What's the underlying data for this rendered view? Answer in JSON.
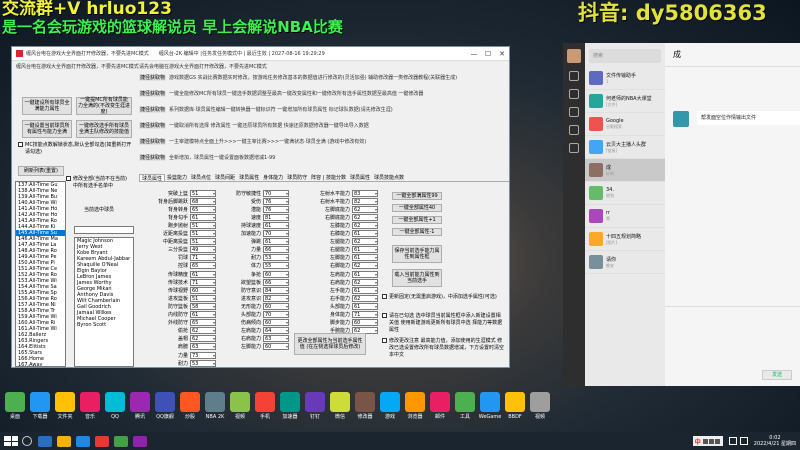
{
  "overlay": {
    "line1": "交流群+V hrluo123",
    "line2": "是一名会玩游戏的篮球解说员 早上会解说NBA比赛",
    "douyin": "抖音: dy5806363"
  },
  "window": {
    "title": "缠风台电在游戏大全界面打开修改器，不要先进MC模式",
    "title_extra": "缠风台-2K 编辑中 |任务发任务模式中 | 最近生效 | 2027-08-16 19:29:29",
    "close": "✕",
    "min": "—",
    "max": "☐"
  },
  "colors": {
    "overlay_yellow": "#f2f23a",
    "overlay_green": "#3cf250",
    "selection": "#0078d7"
  },
  "subtitle": [
    "缠风台电在游戏大全界面打开修改器，不要先进MC模式",
    "请先会电脑在游戏大全界面打开修改器，不要先进MC模式"
  ],
  "hotkeys": [
    {
      "k": "捷径获取物",
      "v": "游戏数据GS  实战比赛数据实时修改，按游戏任务修改基本的数据值进行修改的(灵活加强)  辅助修改器一类修改器教程(关联器生成)"
    },
    {
      "k": "捷径获取物",
      "v": "一键全能修改MC所有球员一键选手数据调整至最高一键改变属性和一键修改所有选手属性数据至最高值 一键修改器"
    },
    {
      "k": "捷径获取物",
      "v": "系列数据库·球员属性编辑一键转换器一键标识符 一键增加所有球员属性 标记球队数据(请先修改生涯)"
    },
    {
      "k": "捷径获取物",
      "v": "一键取消所有选择 修改属性 一键还原球员所有数据 快速还原数据修改器一键导出导入数据"
    },
    {
      "k": "捷径获取物",
      "v": "一主宰建模特点全面上升>>>一键主宰比赛>>>一键满状态·球员全满 (游戏中修改有效)"
    },
    {
      "k": "捷径获取物",
      "v": "全新增加，球员属性一键设置面板数据增减1-99"
    }
  ],
  "left_buttons": [
    "一键建设所有球员全满能力属性",
    "一键提MC所有球员能力全满的(不改变生涯进度)",
    "一键设置当前球员所有属性与能力全满",
    "一键修改选手所有球员全满主队修改的技能值"
  ],
  "left_check": "MC技能点数解锁状态,默认全部勾选(如重新打开请勾选)",
  "refresh_btn": "刷新列表(重置)",
  "right_chk_note": "修改全部(当前不在当前)中所有选手名单中",
  "select_btn": "当前选中球员",
  "player_list": [
    "137.All-Time Gu",
    "138.All-Time Ne",
    "139.All-Time Bu",
    "140.All-Time Wi",
    "141.All-Time Ho",
    "142.All-Time Ho",
    "143.All-Time Ro",
    "144.All-Time Ki",
    "145.All-Time Su",
    "146.All-Time Ma",
    "147.All-Time La",
    "148.All-Time Ro",
    "149.All-Time Pe",
    "150.All-Time Pi",
    "151.All-Time Ce",
    "152.All-Time Ro",
    "153.All-Time Wi",
    "154.All-Time Sa",
    "155.All-Time Sp",
    "156.All-Time Ro",
    "157.All-Time Ni",
    "158.All-Time Tr",
    "159.All-Time Wi",
    "160.All-Time Ri",
    "161.All-Time Wi",
    "162.Ballerz",
    "163.Ringers",
    "164.Elitists",
    "165.Stars",
    "166.Home",
    "167.Away",
    "168.USA",
    "169.World"
  ],
  "selected_player_index": 8,
  "roster": [
    "Magic Johnson",
    "Jerry West",
    "Kobe Bryant",
    "Kareem Abdul-Jabbar",
    "Shaquille O'Neal",
    "Elgin Baylor",
    "LeBron James",
    "James Worthy",
    "George Mikan",
    "Anthony Davis",
    "Wilt Chamberlain",
    "Gail Goodrich",
    "Jamaal Wilkes",
    "Michael Cooper",
    "Byron Scott"
  ],
  "tabs": [
    "球员属性",
    "投篮能力",
    "球员点位",
    "球员间距",
    "球员属性",
    "身体能力",
    "球员防守",
    "阵容 | 技能分数",
    "球员属性",
    "球员技能点数"
  ],
  "col1": [
    [
      "突破上篮",
      "51"
    ],
    [
      "背身后脚跳跃",
      "68"
    ],
    [
      "背身转身",
      "65"
    ],
    [
      "背身勾手",
      "61"
    ],
    [
      "跑步抛射",
      "51"
    ],
    [
      "近距离投篮",
      "51"
    ],
    [
      "中距离投篮",
      "51"
    ],
    [
      "三分投篮",
      "49"
    ],
    [
      "罚球",
      "71"
    ],
    [
      "控球",
      "65"
    ],
    [
      "传球精度",
      "61"
    ],
    [
      "传球技术",
      "71"
    ],
    [
      "传球视野",
      "60"
    ],
    [
      "进攻篮板",
      "51"
    ],
    [
      "防守篮板",
      "58"
    ],
    [
      "内线防守",
      "61"
    ],
    [
      "外线防守",
      "65"
    ],
    [
      "偷抢",
      "62"
    ],
    [
      "盖帽",
      "62"
    ],
    [
      "肩膀",
      "63"
    ],
    [
      "力量",
      "73"
    ],
    [
      "耐力",
      "53"
    ]
  ],
  "col2": [
    [
      "防守敏捷性",
      "70"
    ],
    [
      "受伤",
      "76"
    ],
    [
      "潜能",
      "76"
    ],
    [
      "速度",
      "81"
    ],
    [
      "持球速度",
      "61"
    ],
    [
      "加速能力",
      "70"
    ],
    [
      "弹跳",
      "61"
    ],
    [
      "力量",
      "66"
    ],
    [
      "耐力",
      "53"
    ],
    [
      "体力",
      "55"
    ],
    [
      "争抢",
      "60"
    ],
    [
      "欲望篮板",
      "66"
    ],
    [
      "防守意识",
      "84"
    ],
    [
      "进攻意识",
      "82"
    ],
    [
      "无形能力",
      "60"
    ],
    [
      "头部能力",
      "70"
    ],
    [
      "伤病倾向",
      "60"
    ],
    [
      "左肩能力",
      "64"
    ],
    [
      "右肩能力",
      "63"
    ],
    [
      "左脚能力",
      "60"
    ]
  ],
  "col3": [
    [
      "左射水平能力",
      "83"
    ],
    [
      "右射水平能力",
      "82"
    ],
    [
      "左脚底能力",
      "62"
    ],
    [
      "右脚底能力",
      "62"
    ],
    [
      "左膝能力",
      "62"
    ],
    [
      "右膝能力",
      "61"
    ],
    [
      "左腿能力",
      "62"
    ],
    [
      "右腿能力",
      "61"
    ],
    [
      "左脚能力",
      "61"
    ],
    [
      "右脚能力",
      "62"
    ],
    [
      "左肩能力",
      "61"
    ],
    [
      "右肩能力",
      "62"
    ],
    [
      "左手能力",
      "61"
    ],
    [
      "右手能力",
      "62"
    ],
    [
      "头部能力",
      "61"
    ],
    [
      "身体能力",
      "71"
    ],
    [
      "脚步能力",
      "60"
    ],
    [
      "手腕能力",
      "62"
    ]
  ],
  "mid_buttons": [
    "一键全部满属性99",
    "一键全部属性40",
    "一键全部属性+1",
    "一键全部属性-1",
    "保存当前选手能力属性到属性框",
    "载入当前能力属性到当前选手"
  ],
  "checks": [
    "更新固定(无需重启游戏)，中添加选手属性(可选)",
    "请在已勾选 选中球员当前属性框中添入新建设置相关值 使用新建游戏更新所有球员中选 择能力等数据属性",
    "修改更改注意 最高能力值，添加使用的生涯模式 修改已选设置修改所有球员数据增减，下方设置时清空本中文"
  ],
  "bottom_btn": "更改全部属性为当前选手属性值 (在左侧选择球员后修改)",
  "chat": {
    "search": "搜索",
    "items": [
      {
        "name": "文件传输助手",
        "msg": "1"
      },
      {
        "name": "何老师的NBA大课堂",
        "msg": "[文件]"
      },
      {
        "name": "Google",
        "msg": "谷歌搜索"
      },
      {
        "name": "云贝大主播人头群",
        "msg": "[链接]"
      },
      {
        "name": "成",
        "msg": "好的"
      },
      {
        "name": "34.",
        "msg": "收到"
      },
      {
        "name": "rr",
        "msg": "嗯"
      },
      {
        "name": "十四五规划简略",
        "msg": "[图片]"
      },
      {
        "name": "请你",
        "msg": "晚安"
      }
    ],
    "selected": 4,
    "header": "成",
    "bubble": "帮发面空位作情输出文件",
    "send": "发送"
  },
  "taskbar": {
    "time": "0:02",
    "date": "2022/4/21 星期四",
    "ime": "中"
  },
  "desktop_icons": [
    "桌面",
    "下载器",
    "文件夹",
    "音乐",
    "QQ",
    "腾讯",
    "QQ旗舰",
    "炒股",
    "NBA 2K",
    "视频",
    "手机",
    "加速器",
    "钉钉",
    "微信",
    "修改器",
    "游戏",
    "浏览器",
    "邮件",
    "工具",
    "WeGame",
    "BBDF",
    "视频"
  ]
}
